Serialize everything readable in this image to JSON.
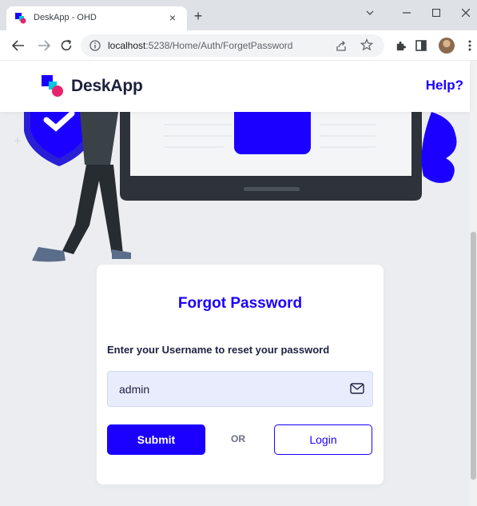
{
  "browser": {
    "tab_title": "DeskApp - OHD",
    "url_host": "localhost",
    "url_rest": ":5238/Home/Auth/ForgetPassword",
    "tab_close_glyph": "×",
    "new_tab_glyph": "+"
  },
  "header": {
    "brand_name": "DeskApp",
    "help_link": "Help?"
  },
  "form": {
    "title": "Forgot Password",
    "subtitle": "Enter your Username to reset your password",
    "username_value": "admin",
    "submit_label": "Submit",
    "or_label": "OR",
    "login_label": "Login"
  },
  "colors": {
    "accent": "#1b00ff",
    "page_bg": "#ecedf1",
    "card_bg": "#ffffff",
    "field_bg": "#e9ecfc"
  },
  "icons": [
    "favicon-icon",
    "close-icon",
    "plus-icon",
    "chevron-down-icon",
    "minimize-icon",
    "maximize-icon",
    "window-close-icon",
    "back-arrow-icon",
    "forward-arrow-icon",
    "reload-icon",
    "info-icon",
    "share-icon",
    "star-icon",
    "extensions-icon",
    "side-panel-icon",
    "avatar",
    "more-icon",
    "deskapp-logo-icon",
    "envelope-icon"
  ]
}
